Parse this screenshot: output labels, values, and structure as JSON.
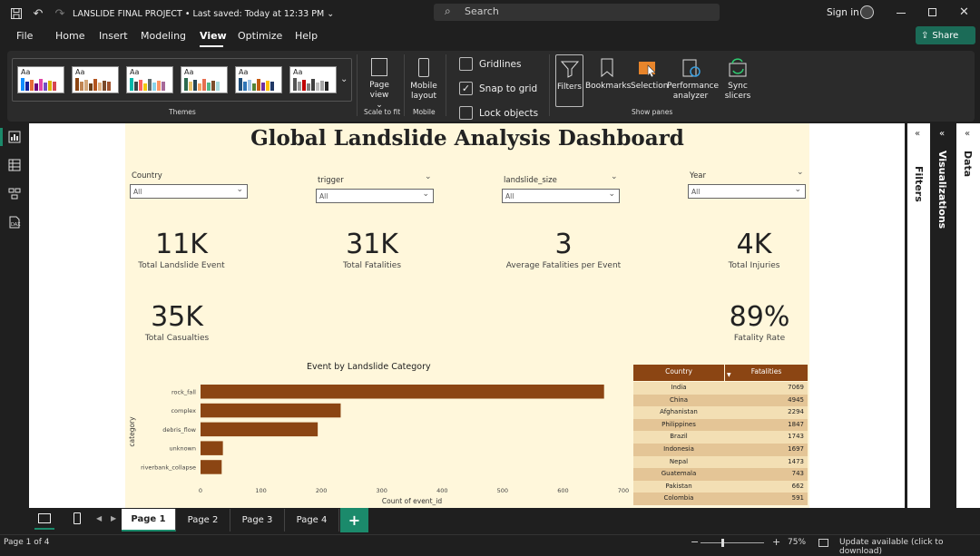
{
  "titlebar": {
    "document_title": "LANSLIDE FINAL PROJECT",
    "saved_status": "Last saved: Today at 12:33 PM",
    "search_placeholder": "Search",
    "sign_in": "Sign in"
  },
  "menu": {
    "items": [
      "File",
      "Home",
      "Insert",
      "Modeling",
      "View",
      "Optimize",
      "Help"
    ],
    "active": "View",
    "share": "Share"
  },
  "ribbon": {
    "themes_label": "Themes",
    "page_view": "Page view",
    "scale_to_fit": "Scale to fit",
    "mobile_layout": "Mobile layout",
    "mobile_group": "Mobile",
    "gridlines": "Gridlines",
    "snap_to_grid": "Snap to grid",
    "lock_objects": "Lock objects",
    "filters": "Filters",
    "bookmarks": "Bookmarks",
    "selection": "Selection",
    "performance_analyzer": "Performance analyzer",
    "sync_slicers": "Sync slicers",
    "show_panes": "Show panes",
    "checkboxes": {
      "gridlines": false,
      "snap_to_grid": true,
      "lock_objects": false
    }
  },
  "report": {
    "title": "Global Landslide Analysis Dashboard",
    "slicers": [
      {
        "label": "Country",
        "value": "All"
      },
      {
        "label": "trigger",
        "value": "All"
      },
      {
        "label": "landslide_size",
        "value": "All"
      },
      {
        "label": "Year",
        "value": "All"
      }
    ],
    "kpis": [
      {
        "value": "11K",
        "label": "Total Landslide Event"
      },
      {
        "value": "31K",
        "label": "Total Fatalities"
      },
      {
        "value": "3",
        "label": "Average Fatalities per Event"
      },
      {
        "value": "4K",
        "label": "Total Injuries"
      },
      {
        "value": "35K",
        "label": "Total Casualties"
      },
      {
        "value": "89%",
        "label": "Fatality Rate"
      }
    ],
    "table": {
      "headers": [
        "Country",
        "Fatalities"
      ],
      "rows": [
        [
          "India",
          "7069"
        ],
        [
          "China",
          "4945"
        ],
        [
          "Afghanistan",
          "2294"
        ],
        [
          "Philippines",
          "1847"
        ],
        [
          "Brazil",
          "1743"
        ],
        [
          "Indonesia",
          "1697"
        ],
        [
          "Nepal",
          "1473"
        ],
        [
          "Guatemala",
          "743"
        ],
        [
          "Pakistan",
          "662"
        ],
        [
          "Colombia",
          "591"
        ]
      ]
    }
  },
  "chart_data": {
    "type": "bar",
    "orientation": "horizontal",
    "title": "Event by Landslide Category",
    "xlabel": "Count of event_id",
    "ylabel": "category",
    "categories": [
      "rock_fall",
      "complex",
      "debris_flow",
      "unknown",
      "riverbank_collapse"
    ],
    "values": [
      668,
      232,
      194,
      37,
      35
    ],
    "xlim": [
      0,
      700
    ],
    "xticks": [
      "0",
      "100",
      "200",
      "300",
      "400",
      "500",
      "600",
      "700"
    ],
    "bar_color": "#8b4513"
  },
  "panes": {
    "filters": "Filters",
    "visualizations": "Visualizations",
    "data": "Data"
  },
  "pages": {
    "tabs": [
      "Page 1",
      "Page 2",
      "Page 3",
      "Page 4"
    ],
    "active": "Page 1"
  },
  "status": {
    "page_info": "Page 1 of 4",
    "zoom": "75%",
    "update": "Update available (click to download)"
  }
}
